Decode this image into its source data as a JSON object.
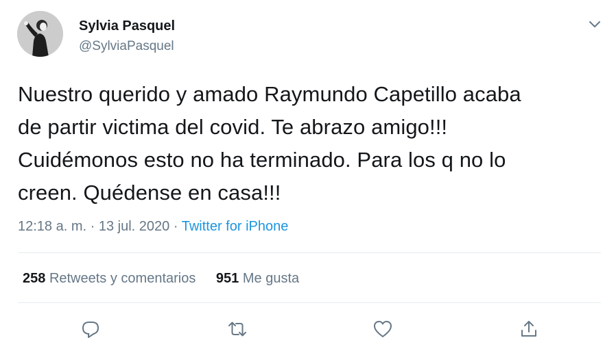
{
  "user": {
    "name": "Sylvia Pasquel",
    "handle": "@SylviaPasquel"
  },
  "tweet": {
    "lines": [
      "Nuestro querido y amado Raymundo Capetillo acaba",
      "de partir victima del covid. Te abrazo amigo!!!",
      "Cuidémonos esto no ha terminado. Para los q no lo",
      "creen. Quédense en casa!!!"
    ],
    "time": "12:18 a. m.",
    "separator": "·",
    "date": "13 jul. 2020",
    "source": "Twitter for iPhone"
  },
  "stats": {
    "retweets_count": "258",
    "retweets_label": "Retweets y comentarios",
    "likes_count": "951",
    "likes_label": "Me gusta"
  },
  "icons": {
    "menu": "chevron-down-icon",
    "reply": "reply-icon",
    "retweet": "retweet-icon",
    "like": "heart-icon",
    "share": "share-icon"
  },
  "colors": {
    "text": "#14171a",
    "secondary": "#657786",
    "link": "#1b95e0",
    "divider": "#e6ecf0"
  }
}
